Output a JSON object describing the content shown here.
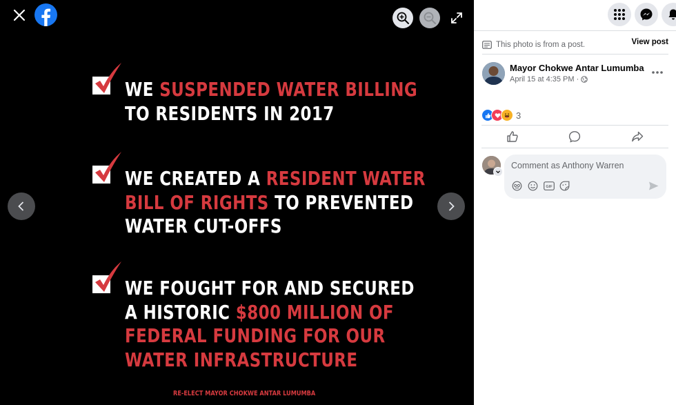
{
  "viewer": {
    "poster": {
      "items": [
        {
          "lines": [
            [
              {
                "t": "WE ",
                "c": "white"
              },
              {
                "t": "SUSPENDED WATER BILLING",
                "c": "red"
              }
            ],
            [
              {
                "t": "TO RESIDENTS IN 2017",
                "c": "white"
              }
            ]
          ]
        },
        {
          "lines": [
            [
              {
                "t": "WE CREATED A ",
                "c": "white"
              },
              {
                "t": "RESIDENT WATER",
                "c": "red"
              }
            ],
            [
              {
                "t": "BILL OF RIGHTS",
                "c": "red"
              },
              {
                "t": " TO PREVENTED",
                "c": "white"
              }
            ],
            [
              {
                "t": "WATER CUT-OFFS",
                "c": "white"
              }
            ]
          ]
        },
        {
          "lines": [
            [
              {
                "t": "WE FOUGHT FOR AND SECURED",
                "c": "white"
              }
            ],
            [
              {
                "t": "A HISTORIC ",
                "c": "white"
              },
              {
                "t": "$800 MILLION OF",
                "c": "red"
              }
            ],
            [
              {
                "t": "FEDERAL FUNDING FOR OUR",
                "c": "red"
              }
            ],
            [
              {
                "t": "WATER INFRASTRUCTURE",
                "c": "red"
              }
            ]
          ]
        }
      ],
      "footer": "RE-ELECT MAYOR CHOKWE ANTAR LUMUMBA"
    },
    "colors": {
      "accent_red": "#d63a3f",
      "fb_blue": "#1877f2"
    }
  },
  "panel": {
    "photo_from": "This photo is from a post.",
    "view_post": "View post",
    "author": "Mayor Chokwe Antar Lumumba",
    "date": "April 15 at 4:35 PM",
    "date_sep": "·",
    "reaction_count": "3",
    "reaction_icons": [
      "like-icon",
      "love-icon",
      "haha-icon"
    ],
    "comment_placeholder": "Comment as Anthony Warren",
    "comment_tools": [
      "avatar-sticker-icon",
      "emoji-icon",
      "gif-icon",
      "sticker-icon"
    ]
  }
}
